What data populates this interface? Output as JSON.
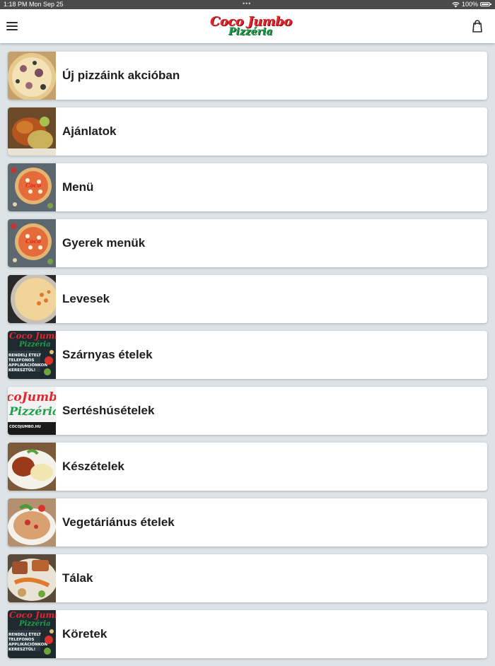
{
  "status_bar": {
    "time": "1:18 PM",
    "date": "Mon Sep 25",
    "battery": "100%"
  },
  "header": {
    "logo_line1": "Coco Jumbo",
    "logo_line2": "Pizzéria",
    "menu_icon": "hamburger-menu-icon",
    "cart_icon": "shopping-bag-icon"
  },
  "categories": [
    {
      "label": "Új pizzáink akcióban",
      "thumb": "pizza-photo"
    },
    {
      "label": "Ajánlatok",
      "thumb": "grilled-chicken-photo"
    },
    {
      "label": "Menü",
      "thumb": "pizza-logo-photo"
    },
    {
      "label": "Gyerek menük",
      "thumb": "pizza-logo-photo"
    },
    {
      "label": "Levesek",
      "thumb": "soup-photo"
    },
    {
      "label": "Szárnyas ételek",
      "thumb": "promo-banner"
    },
    {
      "label": "Sertéshúsételek",
      "thumb": "logo-banner"
    },
    {
      "label": "Készételek",
      "thumb": "stew-photo"
    },
    {
      "label": "Vegetáriánus ételek",
      "thumb": "vegetable-dish-photo"
    },
    {
      "label": "Tálak",
      "thumb": "platter-photo"
    },
    {
      "label": "Köretek",
      "thumb": "promo-banner"
    }
  ],
  "colors": {
    "logo_red": "#e3262e",
    "logo_green": "#1f9e4a",
    "background": "#dde3e6"
  }
}
